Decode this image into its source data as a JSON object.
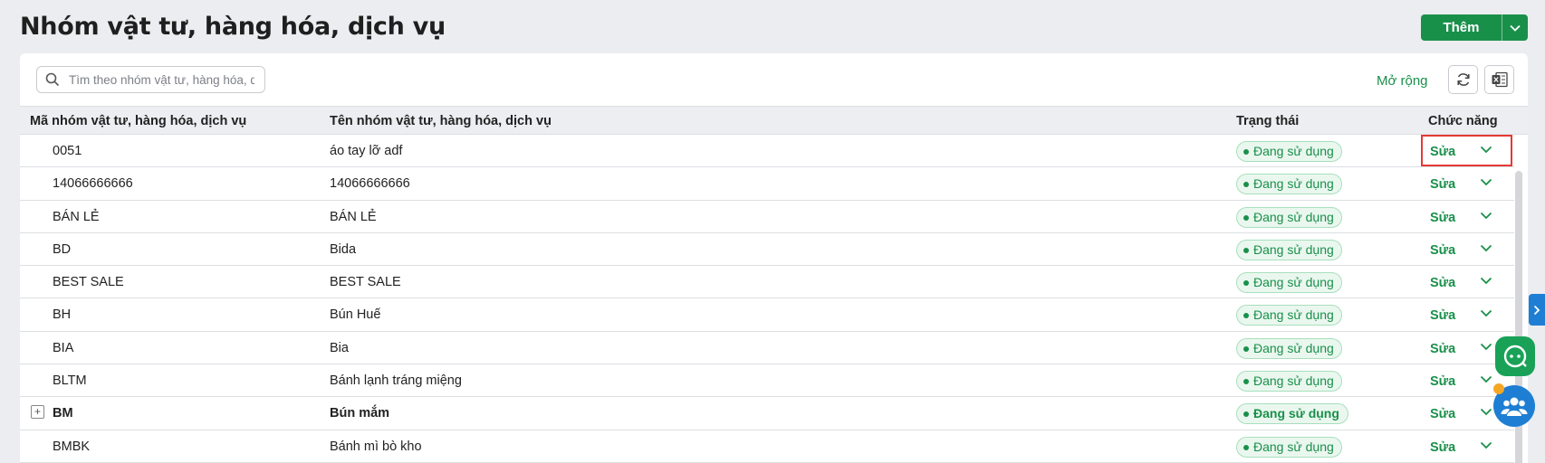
{
  "page": {
    "title": "Nhóm vật tư, hàng hóa, dịch vụ"
  },
  "toolbar": {
    "add_label": "Thêm",
    "search_placeholder": "Tìm theo nhóm vật tư, hàng hóa, dịch vụ",
    "expand_label": "Mở rộng"
  },
  "table": {
    "headers": {
      "code": "Mã nhóm vật tư, hàng hóa, dịch vụ",
      "name": "Tên nhóm vật tư, hàng hóa, dịch vụ",
      "status": "Trạng thái",
      "actions": "Chức năng"
    },
    "rows": [
      {
        "code": "0051",
        "name": "áo tay lỡ adf",
        "status": "Đang sử dụng",
        "action": "Sửa"
      },
      {
        "code": "14066666666",
        "name": "14066666666",
        "status": "Đang sử dụng",
        "action": "Sửa"
      },
      {
        "code": "BÁN LẺ",
        "name": "BÁN LẺ",
        "status": "Đang sử dụng",
        "action": "Sửa"
      },
      {
        "code": "BD",
        "name": "Bida",
        "status": "Đang sử dụng",
        "action": "Sửa"
      },
      {
        "code": "BEST SALE",
        "name": "BEST SALE",
        "status": "Đang sử dụng",
        "action": "Sửa"
      },
      {
        "code": "BH",
        "name": "Bún Huế",
        "status": "Đang sử dụng",
        "action": "Sửa"
      },
      {
        "code": "BIA",
        "name": "Bia",
        "status": "Đang sử dụng",
        "action": "Sửa"
      },
      {
        "code": "BLTM",
        "name": "Bánh lạnh tráng miệng",
        "status": "Đang sử dụng",
        "action": "Sửa"
      },
      {
        "code": "BM",
        "name": "Bún mắm",
        "status": "Đang sử dụng",
        "action": "Sửa",
        "expand_symbol": "+"
      },
      {
        "code": "BMBK",
        "name": "Bánh mì bò kho",
        "status": "Đang sử dụng",
        "action": "Sửa"
      }
    ]
  },
  "colors": {
    "primary": "#19904a",
    "accent_blue": "#1e7ed3",
    "focus": "#e53935"
  },
  "icons": [
    "search-icon",
    "chevron-down-icon",
    "refresh-icon",
    "excel-icon",
    "chevron-right-icon",
    "chat-bot-icon",
    "team-icon"
  ]
}
